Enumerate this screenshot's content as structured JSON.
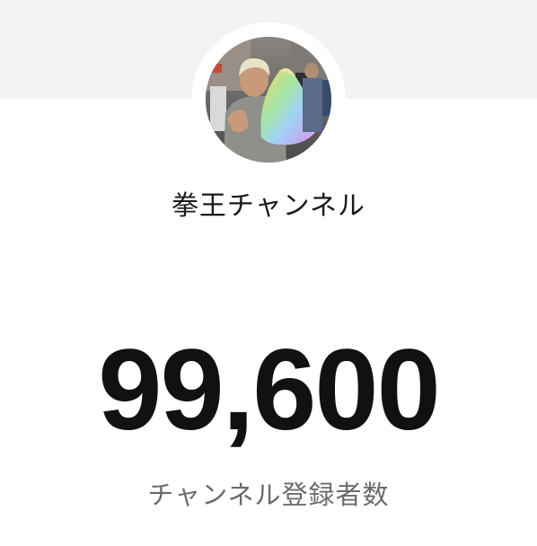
{
  "channel": {
    "name": "拳王チャンネル",
    "subscriber_count": "99,600",
    "subscriber_label": "チャンネル登録者数"
  },
  "colors": {
    "header_band": "#f3f3f3",
    "count_text": "#111111",
    "label_text": "#6b6b6b"
  }
}
